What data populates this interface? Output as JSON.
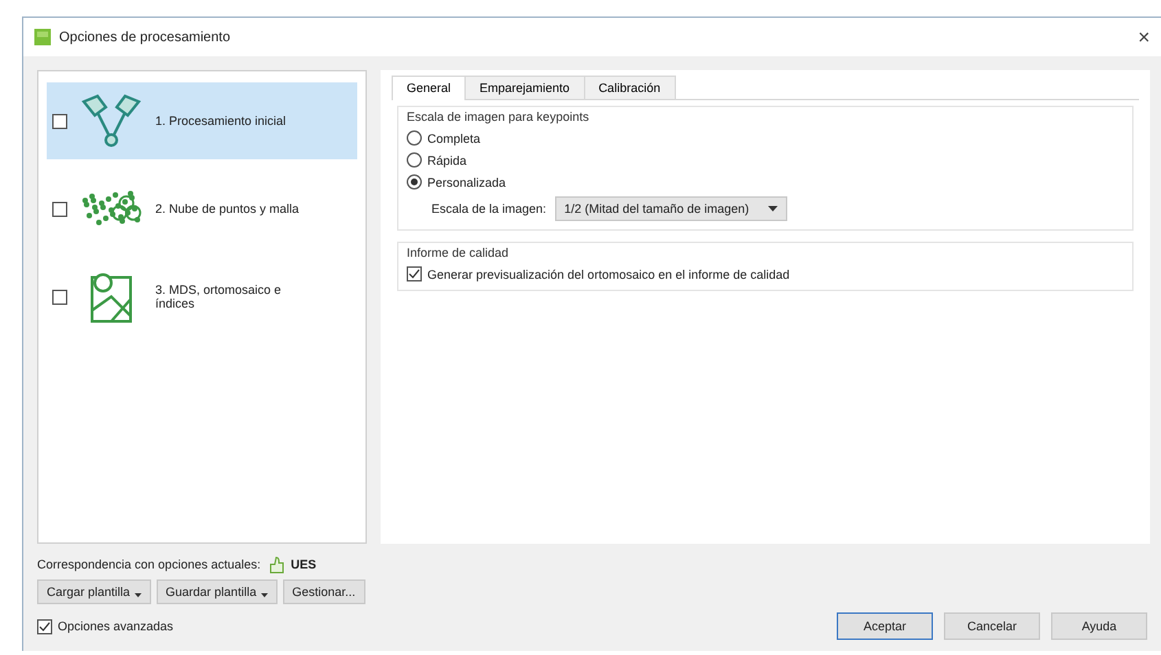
{
  "window": {
    "title": "Opciones de procesamiento",
    "close": "×"
  },
  "steps": [
    {
      "kind": "keypoints",
      "label": "1. Procesamiento inicial",
      "checked": false,
      "selected": true
    },
    {
      "kind": "cloud",
      "label": "2. Nube de puntos y malla",
      "checked": false,
      "selected": false
    },
    {
      "kind": "map",
      "label": "3. MDS, ortomosaico e índices",
      "checked": false,
      "selected": false
    }
  ],
  "tabs": [
    {
      "label": "General",
      "selected": true
    },
    {
      "label": "Emparejamiento",
      "selected": false
    },
    {
      "label": "Calibración",
      "selected": false
    }
  ],
  "scale_group": {
    "title": "Escala de imagen para keypoints",
    "options": [
      {
        "label": "Completa",
        "selected": false
      },
      {
        "label": "Rápida",
        "selected": false
      },
      {
        "label": "Personalizada",
        "selected": true
      }
    ],
    "scale_label": "Escala de la imagen:",
    "scale_value": "1/2 (Mitad del tamaño de imagen)"
  },
  "quality_group": {
    "title": "Informe de calidad",
    "option": {
      "label": "Generar previsualización del ortomosaico en el informe de calidad",
      "checked": true
    }
  },
  "match": {
    "label": "Correspondencia con opciones actuales:",
    "value": "UES"
  },
  "template_buttons": [
    {
      "label": "Cargar plantilla",
      "menu": true
    },
    {
      "label": "Guardar plantilla",
      "menu": true
    },
    {
      "label": "Gestionar...",
      "menu": false
    }
  ],
  "advanced": {
    "label": "Opciones avanzadas",
    "checked": true
  },
  "dialog_buttons": [
    {
      "label": "Aceptar",
      "default": true
    },
    {
      "label": "Cancelar",
      "default": false
    },
    {
      "label": "Ayuda",
      "default": false
    }
  ]
}
